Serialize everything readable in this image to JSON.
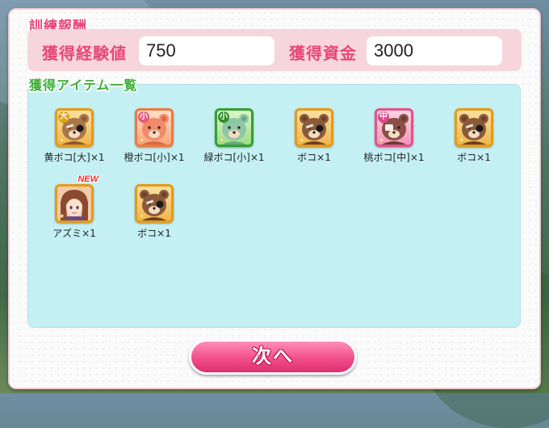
{
  "reward_title": "訓練報酬",
  "stats": {
    "exp_label": "獲得経験値",
    "exp_value": "750",
    "funds_label": "獲得資金",
    "funds_value": "3000"
  },
  "items_title": "獲得アイテム一覧",
  "items": [
    {
      "name": "黄ボコ[大]×1",
      "badge": "大",
      "frame": "gold",
      "icon": "yellow-boko-bear-icon"
    },
    {
      "name": "橙ボコ[小]×1",
      "badge": "小",
      "frame": "orange",
      "icon": "orange-boko-bear-icon"
    },
    {
      "name": "緑ボコ[小]×1",
      "badge": "小",
      "frame": "green",
      "icon": "green-boko-bear-icon"
    },
    {
      "name": "ボコ×1",
      "badge": "",
      "frame": "gold",
      "icon": "boko-bear-icon"
    },
    {
      "name": "桃ボコ[中]×1",
      "badge": "中",
      "frame": "pink",
      "icon": "pink-boko-bear-icon"
    },
    {
      "name": "ボコ×1",
      "badge": "",
      "frame": "gold",
      "icon": "boko-bear-icon"
    },
    {
      "name": "アズミ×1",
      "badge": "",
      "frame": "gold",
      "icon": "azumi-portrait-icon",
      "tag": "NEW"
    },
    {
      "name": "ボコ×1",
      "badge": "",
      "frame": "gold",
      "icon": "boko-bear-icon"
    }
  ],
  "next_button": "次へ",
  "colors": {
    "accent_pink": "#e8477a",
    "item_area": "#c4f0f4",
    "stat_bar": "#f7d5dd"
  }
}
